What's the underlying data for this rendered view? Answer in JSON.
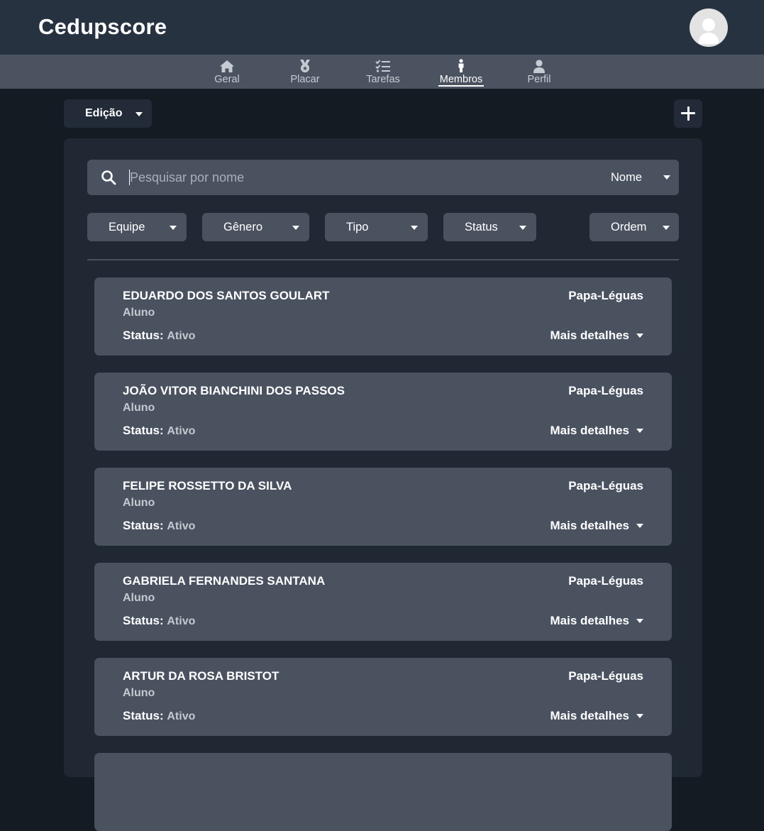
{
  "app": {
    "title": "Cedupscore"
  },
  "header": {
    "avatar_icon": "user-avatar-icon"
  },
  "nav": {
    "items": [
      {
        "label": "Geral",
        "icon": "home-icon",
        "active": false
      },
      {
        "label": "Placar",
        "icon": "medal-icon",
        "active": false
      },
      {
        "label": "Tarefas",
        "icon": "checklist-icon",
        "active": false
      },
      {
        "label": "Membros",
        "icon": "person-icon",
        "active": true
      },
      {
        "label": "Perfil",
        "icon": "profile-icon",
        "active": false
      }
    ]
  },
  "toolbar": {
    "edition_label": "Edição",
    "add_icon": "plus-icon"
  },
  "search": {
    "placeholder": "Pesquisar por nome",
    "value": "",
    "mode": "Nome"
  },
  "filters": [
    {
      "label": "Equipe"
    },
    {
      "label": "Gênero"
    },
    {
      "label": "Tipo"
    },
    {
      "label": "Status"
    },
    {
      "label": "Ordem"
    }
  ],
  "members": [
    {
      "name": "EDUARDO DOS SANTOS GOULART",
      "role": "Aluno",
      "status_label": "Status:",
      "status": "Ativo",
      "team": "Papa-Léguas",
      "details": "Mais detalhes"
    },
    {
      "name": "JOÃO VITOR BIANCHINI DOS PASSOS",
      "role": "Aluno",
      "status_label": "Status:",
      "status": "Ativo",
      "team": "Papa-Léguas",
      "details": "Mais detalhes"
    },
    {
      "name": "FELIPE ROSSETTO DA SILVA",
      "role": "Aluno",
      "status_label": "Status:",
      "status": "Ativo",
      "team": "Papa-Léguas",
      "details": "Mais detalhes"
    },
    {
      "name": "GABRIELA FERNANDES SANTANA",
      "role": "Aluno",
      "status_label": "Status:",
      "status": "Ativo",
      "team": "Papa-Léguas",
      "details": "Mais detalhes"
    },
    {
      "name": "ARTUR DA ROSA BRISTOT",
      "role": "Aluno",
      "status_label": "Status:",
      "status": "Ativo",
      "team": "Papa-Léguas",
      "details": "Mais detalhes"
    }
  ],
  "colors": {
    "background": "#151b23",
    "header": "#273241",
    "navbar": "#4b5361",
    "panel": "#1f2833",
    "card": "#4a5260",
    "muted_text": "#c4c9d0"
  }
}
